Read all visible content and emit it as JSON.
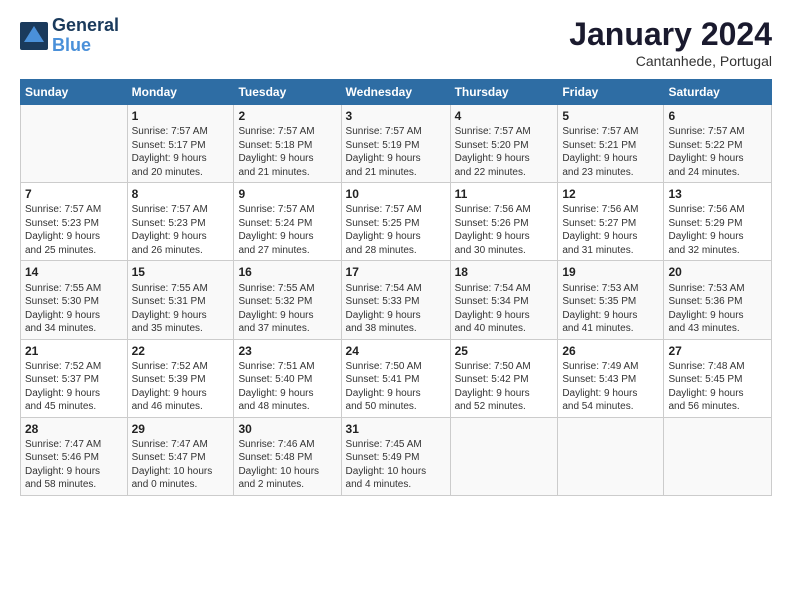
{
  "header": {
    "logo_line1": "General",
    "logo_line2": "Blue",
    "month": "January 2024",
    "location": "Cantanhede, Portugal"
  },
  "weekdays": [
    "Sunday",
    "Monday",
    "Tuesday",
    "Wednesday",
    "Thursday",
    "Friday",
    "Saturday"
  ],
  "weeks": [
    [
      {
        "day": "",
        "info": ""
      },
      {
        "day": "1",
        "info": "Sunrise: 7:57 AM\nSunset: 5:17 PM\nDaylight: 9 hours\nand 20 minutes."
      },
      {
        "day": "2",
        "info": "Sunrise: 7:57 AM\nSunset: 5:18 PM\nDaylight: 9 hours\nand 21 minutes."
      },
      {
        "day": "3",
        "info": "Sunrise: 7:57 AM\nSunset: 5:19 PM\nDaylight: 9 hours\nand 21 minutes."
      },
      {
        "day": "4",
        "info": "Sunrise: 7:57 AM\nSunset: 5:20 PM\nDaylight: 9 hours\nand 22 minutes."
      },
      {
        "day": "5",
        "info": "Sunrise: 7:57 AM\nSunset: 5:21 PM\nDaylight: 9 hours\nand 23 minutes."
      },
      {
        "day": "6",
        "info": "Sunrise: 7:57 AM\nSunset: 5:22 PM\nDaylight: 9 hours\nand 24 minutes."
      }
    ],
    [
      {
        "day": "7",
        "info": "Sunrise: 7:57 AM\nSunset: 5:23 PM\nDaylight: 9 hours\nand 25 minutes."
      },
      {
        "day": "8",
        "info": "Sunrise: 7:57 AM\nSunset: 5:23 PM\nDaylight: 9 hours\nand 26 minutes."
      },
      {
        "day": "9",
        "info": "Sunrise: 7:57 AM\nSunset: 5:24 PM\nDaylight: 9 hours\nand 27 minutes."
      },
      {
        "day": "10",
        "info": "Sunrise: 7:57 AM\nSunset: 5:25 PM\nDaylight: 9 hours\nand 28 minutes."
      },
      {
        "day": "11",
        "info": "Sunrise: 7:56 AM\nSunset: 5:26 PM\nDaylight: 9 hours\nand 30 minutes."
      },
      {
        "day": "12",
        "info": "Sunrise: 7:56 AM\nSunset: 5:27 PM\nDaylight: 9 hours\nand 31 minutes."
      },
      {
        "day": "13",
        "info": "Sunrise: 7:56 AM\nSunset: 5:29 PM\nDaylight: 9 hours\nand 32 minutes."
      }
    ],
    [
      {
        "day": "14",
        "info": "Sunrise: 7:55 AM\nSunset: 5:30 PM\nDaylight: 9 hours\nand 34 minutes."
      },
      {
        "day": "15",
        "info": "Sunrise: 7:55 AM\nSunset: 5:31 PM\nDaylight: 9 hours\nand 35 minutes."
      },
      {
        "day": "16",
        "info": "Sunrise: 7:55 AM\nSunset: 5:32 PM\nDaylight: 9 hours\nand 37 minutes."
      },
      {
        "day": "17",
        "info": "Sunrise: 7:54 AM\nSunset: 5:33 PM\nDaylight: 9 hours\nand 38 minutes."
      },
      {
        "day": "18",
        "info": "Sunrise: 7:54 AM\nSunset: 5:34 PM\nDaylight: 9 hours\nand 40 minutes."
      },
      {
        "day": "19",
        "info": "Sunrise: 7:53 AM\nSunset: 5:35 PM\nDaylight: 9 hours\nand 41 minutes."
      },
      {
        "day": "20",
        "info": "Sunrise: 7:53 AM\nSunset: 5:36 PM\nDaylight: 9 hours\nand 43 minutes."
      }
    ],
    [
      {
        "day": "21",
        "info": "Sunrise: 7:52 AM\nSunset: 5:37 PM\nDaylight: 9 hours\nand 45 minutes."
      },
      {
        "day": "22",
        "info": "Sunrise: 7:52 AM\nSunset: 5:39 PM\nDaylight: 9 hours\nand 46 minutes."
      },
      {
        "day": "23",
        "info": "Sunrise: 7:51 AM\nSunset: 5:40 PM\nDaylight: 9 hours\nand 48 minutes."
      },
      {
        "day": "24",
        "info": "Sunrise: 7:50 AM\nSunset: 5:41 PM\nDaylight: 9 hours\nand 50 minutes."
      },
      {
        "day": "25",
        "info": "Sunrise: 7:50 AM\nSunset: 5:42 PM\nDaylight: 9 hours\nand 52 minutes."
      },
      {
        "day": "26",
        "info": "Sunrise: 7:49 AM\nSunset: 5:43 PM\nDaylight: 9 hours\nand 54 minutes."
      },
      {
        "day": "27",
        "info": "Sunrise: 7:48 AM\nSunset: 5:45 PM\nDaylight: 9 hours\nand 56 minutes."
      }
    ],
    [
      {
        "day": "28",
        "info": "Sunrise: 7:47 AM\nSunset: 5:46 PM\nDaylight: 9 hours\nand 58 minutes."
      },
      {
        "day": "29",
        "info": "Sunrise: 7:47 AM\nSunset: 5:47 PM\nDaylight: 10 hours\nand 0 minutes."
      },
      {
        "day": "30",
        "info": "Sunrise: 7:46 AM\nSunset: 5:48 PM\nDaylight: 10 hours\nand 2 minutes."
      },
      {
        "day": "31",
        "info": "Sunrise: 7:45 AM\nSunset: 5:49 PM\nDaylight: 10 hours\nand 4 minutes."
      },
      {
        "day": "",
        "info": ""
      },
      {
        "day": "",
        "info": ""
      },
      {
        "day": "",
        "info": ""
      }
    ]
  ]
}
